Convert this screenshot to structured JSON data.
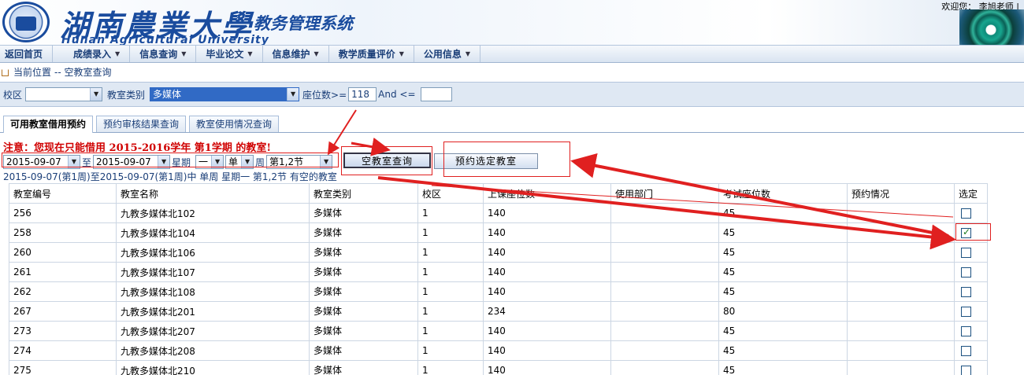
{
  "header": {
    "school_name_cn": "湖南農業大學",
    "school_name_en": "Hunan Agricultural University",
    "system_title": "教务管理系统",
    "welcome_label": "欢迎您：",
    "user_name": "李旭老师",
    "separator": "|"
  },
  "menu": {
    "items": [
      {
        "label": "返回首页"
      },
      {
        "label": "成绩录入"
      },
      {
        "label": "信息查询"
      },
      {
        "label": "毕业论文"
      },
      {
        "label": "信息维护"
      },
      {
        "label": "教学质量评价"
      },
      {
        "label": "公用信息"
      }
    ]
  },
  "breadcrumb": {
    "label": "当前位置",
    "path": "-- 空教室查询"
  },
  "filters": {
    "campus_label": "校区",
    "campus_value": "",
    "room_type_label": "教室类别",
    "room_type_value": "多媒体",
    "seats_label": "座位数>=",
    "seats_min": "118",
    "and_label": "And <=",
    "seats_max": ""
  },
  "tabs": [
    {
      "label": "可用教室借用预约",
      "active": true
    },
    {
      "label": "预约审核结果查询",
      "active": false
    },
    {
      "label": "教室使用情况查询",
      "active": false
    }
  ],
  "notice": "注意：您现在只能借用 2015-2016学年 第1学期 的教室!",
  "criteria": {
    "date_from": "2015-09-07",
    "to_label": "至",
    "date_to": "2015-09-07",
    "weekday_label": "星期",
    "weekday_value": "一",
    "week_type_value": "单",
    "week_label": "周",
    "period_value": "第1,2节"
  },
  "buttons": {
    "query_label": "空教室查询",
    "reserve_label": "预约选定教室"
  },
  "result_line": "2015-09-07(第1周)至2015-09-07(第1周)中 单周 星期一 第1,2节 有空的教室",
  "table": {
    "columns": [
      "教室编号",
      "教室名称",
      "教室类别",
      "校区",
      "上课座位数",
      "使用部门",
      "考试座位数",
      "预约情况",
      "选定"
    ],
    "rows": [
      {
        "id": "256",
        "name": "九教多媒体北102",
        "type": "多媒体",
        "campus": "1",
        "seats": "140",
        "dept": "",
        "exam_seats": "45",
        "status": "",
        "checked": false
      },
      {
        "id": "258",
        "name": "九教多媒体北104",
        "type": "多媒体",
        "campus": "1",
        "seats": "140",
        "dept": "",
        "exam_seats": "45",
        "status": "",
        "checked": true
      },
      {
        "id": "260",
        "name": "九教多媒体北106",
        "type": "多媒体",
        "campus": "1",
        "seats": "140",
        "dept": "",
        "exam_seats": "45",
        "status": "",
        "checked": false
      },
      {
        "id": "261",
        "name": "九教多媒体北107",
        "type": "多媒体",
        "campus": "1",
        "seats": "140",
        "dept": "",
        "exam_seats": "45",
        "status": "",
        "checked": false
      },
      {
        "id": "262",
        "name": "九教多媒体北108",
        "type": "多媒体",
        "campus": "1",
        "seats": "140",
        "dept": "",
        "exam_seats": "45",
        "status": "",
        "checked": false
      },
      {
        "id": "267",
        "name": "九教多媒体北201",
        "type": "多媒体",
        "campus": "1",
        "seats": "234",
        "dept": "",
        "exam_seats": "80",
        "status": "",
        "checked": false
      },
      {
        "id": "273",
        "name": "九教多媒体北207",
        "type": "多媒体",
        "campus": "1",
        "seats": "140",
        "dept": "",
        "exam_seats": "45",
        "status": "",
        "checked": false
      },
      {
        "id": "274",
        "name": "九教多媒体北208",
        "type": "多媒体",
        "campus": "1",
        "seats": "140",
        "dept": "",
        "exam_seats": "45",
        "status": "",
        "checked": false
      },
      {
        "id": "275",
        "name": "九教多媒体北210",
        "type": "多媒体",
        "campus": "1",
        "seats": "140",
        "dept": "",
        "exam_seats": "45",
        "status": "",
        "checked": false
      }
    ]
  },
  "colors": {
    "brand_blue": "#1a4c9e",
    "notice_red": "#d00000",
    "annotation_red": "#e02020",
    "select_highlight": "#316ac5"
  }
}
